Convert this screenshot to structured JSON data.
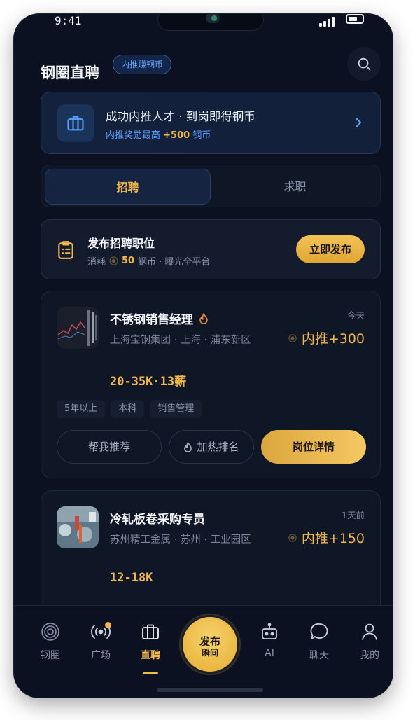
{
  "status_bar": {
    "time": "9:41"
  },
  "header": {
    "title": "钢圈直聘",
    "badge": "内推赚钢币"
  },
  "banner": {
    "title": "成功内推人才 · 到岗即得钢币",
    "sub_prefix": "内推奖励最高",
    "sub_highlight": "+500",
    "sub_suffix": "钢币"
  },
  "segment": {
    "tabs": [
      "招聘",
      "求职"
    ],
    "active": "招聘"
  },
  "post_job": {
    "title": "发布招聘职位",
    "sub_prefix": "消耗",
    "coin_amount": "50",
    "sub_suffix": "钢币 · 曝光全平台",
    "button": "立即发布"
  },
  "jobs": [
    {
      "title": "不锈钢销售经理",
      "company_line": "上海宝钢集团 · 上海 · 浦东新区",
      "salary": "20-35K·13薪",
      "time": "今天",
      "reward": "内推+300",
      "tags": [
        "5年以上",
        "本科",
        "销售管理"
      ],
      "actions": {
        "recommend": "帮我推荐",
        "boost": "加热排名",
        "detail": "岗位详情"
      }
    },
    {
      "title": "冷轧板卷采购专员",
      "company_line": "苏州精工金属 · 苏州 · 工业园区",
      "salary": "12-18K",
      "time": "1天前",
      "reward": "内推+150"
    }
  ],
  "tabbar": {
    "items": [
      "钢圈",
      "广场",
      "直聘",
      "AI",
      "聊天",
      "我的"
    ],
    "active": "直聘",
    "fab_line1": "发布",
    "fab_line2": "瞬间"
  },
  "colors": {
    "background": "#0b1120",
    "accent_gold": "#f2b84b",
    "accent_blue": "#5aa0ff"
  },
  "icons": [
    "search-icon",
    "briefcase-icon",
    "chevron-right-icon",
    "clipboard-icon",
    "flame-icon",
    "coin-icon",
    "rings-icon",
    "broadcast-icon",
    "bot-icon",
    "chat-bubble-icon",
    "user-icon"
  ]
}
